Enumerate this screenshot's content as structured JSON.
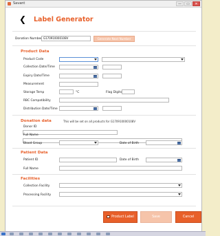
{
  "window": {
    "title": "Savant",
    "minimize": "—",
    "maximize": "▭",
    "close": "✕"
  },
  "header": {
    "title": "Label Generator",
    "back_glyph": "❮"
  },
  "donation": {
    "label": "Donation Number",
    "value": "G170910000108V",
    "generate_label": "Generate Next Number"
  },
  "product": {
    "section": "Product Data",
    "product_code": "Product Code",
    "collection": "Collection Date/Time",
    "expiry": "Expiry Date/Time",
    "measurement": "Measurement",
    "storage_temp": "Storage Temp",
    "temp_unit": "°C",
    "flag_digits": "Flag Digits",
    "rbc": "RBC Compatibility",
    "distribution": "Distribution Date/Time"
  },
  "donation_data": {
    "section": "Donation data",
    "note": "This will be set on all products for G170910000108V",
    "donor_id": "Donor ID",
    "full_name": "Full Name",
    "blood_group": "Blood Group",
    "dob": "Date of Birth"
  },
  "patient": {
    "section": "Patient Data",
    "patient_id": "Patient ID",
    "dob": "Date of Birth",
    "full_name": "Full Name"
  },
  "facilities": {
    "section": "Facilities",
    "collection": "Collection Facility",
    "processing": "Processing Facility"
  },
  "footer": {
    "print": "Product Label",
    "save": "Save",
    "cancel": "Cancel"
  },
  "colors": {
    "accent": "#e8602a",
    "accent_light": "#f6c4aa",
    "background": "#f3edc9"
  }
}
